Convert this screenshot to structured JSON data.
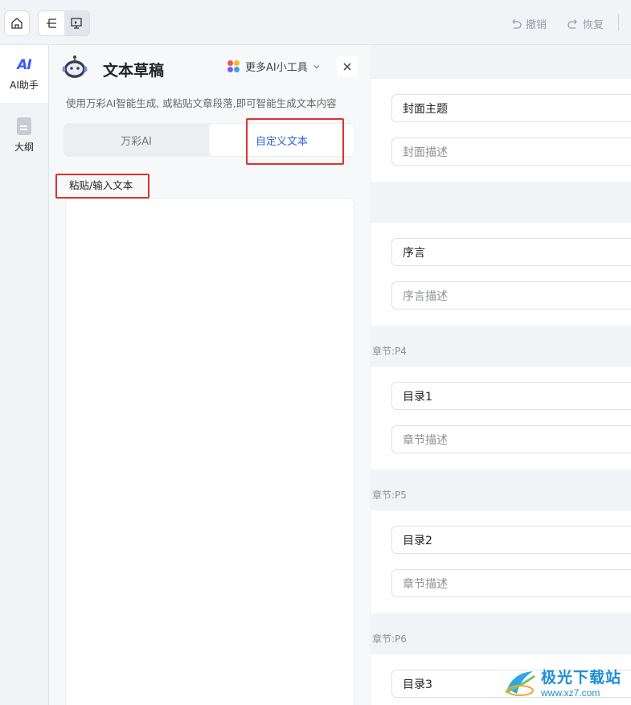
{
  "toolbar": {
    "undo_label": "撤销",
    "redo_label": "恢复"
  },
  "rail": {
    "items": [
      {
        "label": "AI助手",
        "icon": "ai-assistant-icon"
      },
      {
        "label": "大纲",
        "icon": "outline-doc-icon"
      }
    ]
  },
  "panel": {
    "title": "文本草稿",
    "more_tools": "更多AI小工具",
    "description": "使用万彩AI智能生成, 或粘贴文章段落,即可智能生成文本内容",
    "tabs": [
      {
        "label": "万彩AI",
        "active": false
      },
      {
        "label": "自定义文本",
        "active": true
      }
    ],
    "paste_label": "粘贴/输入文本",
    "textarea_value": ""
  },
  "slides": {
    "cover": {
      "title": "封面主题",
      "desc_placeholder": "封面描述"
    },
    "preface": {
      "title": "序言",
      "desc_placeholder": "序言描述"
    },
    "chapters": [
      {
        "label": "章节:P4",
        "title": "目录1",
        "desc_placeholder": "章节描述"
      },
      {
        "label": "章节:P5",
        "title": "目录2",
        "desc_placeholder": "章节描述"
      },
      {
        "label": "章节:P6",
        "title": "目录3",
        "desc_placeholder": ""
      }
    ]
  },
  "watermark": {
    "main": "极光下载站",
    "sub": "www.xz7.com"
  },
  "colors": {
    "accent": "#2b63d9",
    "highlight_box": "#e0302b",
    "ai_logo": "#3b5bf2"
  }
}
